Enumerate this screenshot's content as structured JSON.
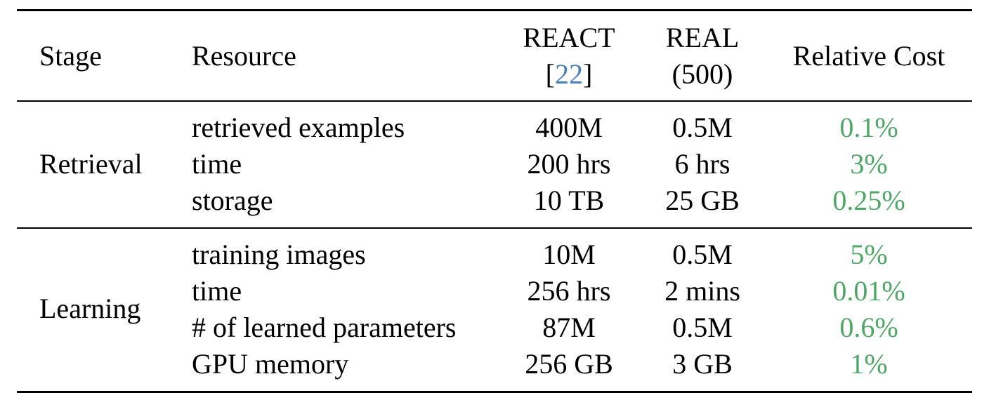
{
  "table": {
    "headers": {
      "stage": "Stage",
      "resource": "Resource",
      "react_line1": "REACT",
      "react_cite_open": "[",
      "react_cite_num": "22",
      "react_cite_close": "]",
      "real_line1": "REAL",
      "real_line2": "(500)",
      "relative_cost": "Relative Cost"
    },
    "groups": [
      {
        "stage": "Retrieval",
        "rows": [
          {
            "resource": "retrieved examples",
            "react": "400M",
            "real": "0.5M",
            "relative": "0.1%"
          },
          {
            "resource": "time",
            "react": "200 hrs",
            "real": "6 hrs",
            "relative": "3%"
          },
          {
            "resource": "storage",
            "react": "10 TB",
            "real": "25 GB",
            "relative": "0.25%"
          }
        ]
      },
      {
        "stage": "Learning",
        "rows": [
          {
            "resource": "training images",
            "react": "10M",
            "real": "0.5M",
            "relative": "5%"
          },
          {
            "resource": "time",
            "react": "256 hrs",
            "real": "2 mins",
            "relative": "0.01%"
          },
          {
            "resource": "# of learned parameters",
            "react": "87M",
            "real": "0.5M",
            "relative": "0.6%"
          },
          {
            "resource": "GPU memory",
            "react": "256 GB",
            "real": "3 GB",
            "relative": "1%"
          }
        ]
      }
    ],
    "colors": {
      "relative_cost": "#4ca864",
      "citation": "#4a7fbf"
    }
  }
}
